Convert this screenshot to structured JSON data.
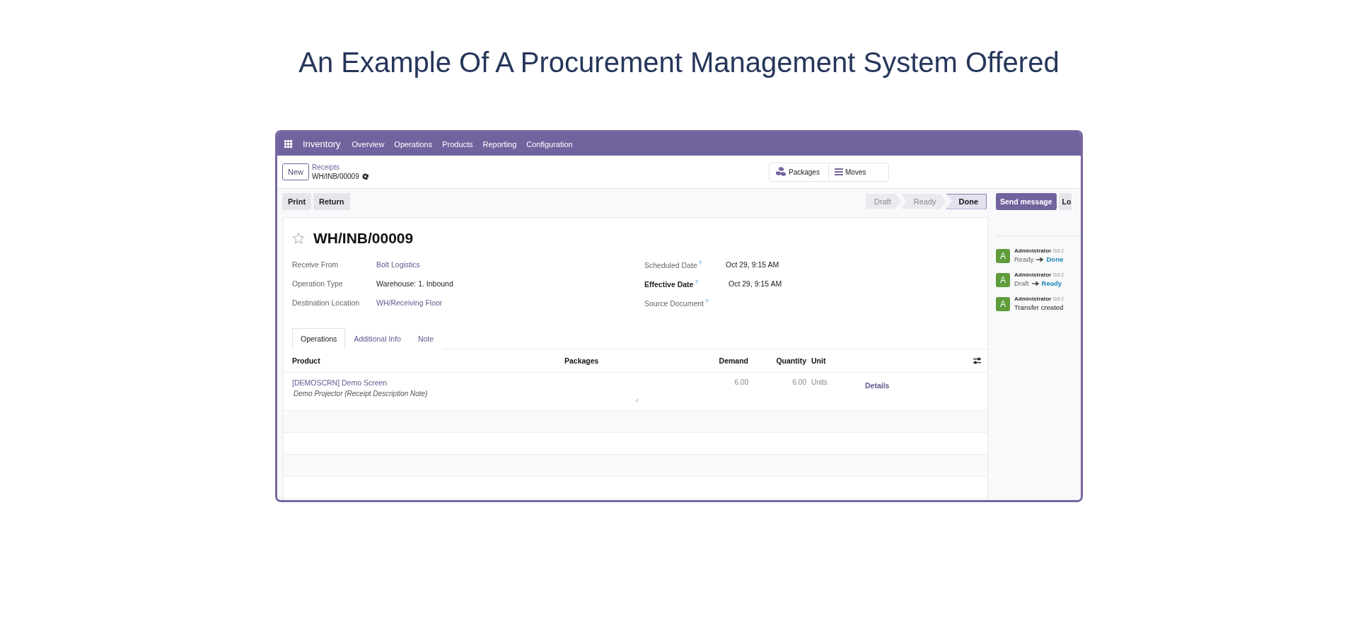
{
  "heading": "An Example Of A Procurement Management System Offered",
  "navbar": {
    "app": "Inventory",
    "menu": [
      "Overview",
      "Operations",
      "Products",
      "Reporting",
      "Configuration"
    ]
  },
  "control_panel": {
    "new_button": "New",
    "breadcrumb": "Receipts",
    "record": "WH/INB/00009",
    "smart_buttons": [
      {
        "label": "Packages",
        "kind": "boxes"
      },
      {
        "label": "Moves",
        "kind": "list"
      }
    ]
  },
  "actions": [
    "Print",
    "Return"
  ],
  "status_steps": [
    {
      "label": "Draft",
      "selected": false
    },
    {
      "label": "Ready",
      "selected": false
    },
    {
      "label": "Done",
      "selected": true
    }
  ],
  "form": {
    "title": "WH/INB/00009",
    "starred": false,
    "left_fields": [
      {
        "label": "Receive From",
        "value": "Bolt Logistics",
        "kind": "link"
      },
      {
        "label": "Operation Type",
        "value": "Warehouse: 1. Inbound",
        "kind": "text"
      },
      {
        "label": "Destination Location",
        "value": "WH/Receiving Floor",
        "kind": "link"
      }
    ],
    "right_fields": [
      {
        "label": "Scheduled Date",
        "help": "?",
        "value": "Oct 29, 9:15 AM",
        "emphasized": false
      },
      {
        "label": "Effective Date",
        "help": "?",
        "value": "Oct 29, 9:15 AM",
        "emphasized": true
      },
      {
        "label": "Source Document",
        "help": "?",
        "emphasized": false
      }
    ]
  },
  "tabs": [
    {
      "label": "Operations",
      "selected": true
    },
    {
      "label": "Additional Info",
      "selected": false
    },
    {
      "label": "Note",
      "selected": false
    }
  ],
  "table": {
    "columns": [
      "Product",
      "Packages",
      "Demand",
      "Quantity",
      "Unit"
    ],
    "rows": [
      {
        "product": "[DEMOSCRN] Demo Screen",
        "description": "Demo Projector (Receipt Description Note)",
        "demand": "6.00",
        "quantity": "6.00",
        "unit": "Units",
        "action": "Details"
      }
    ]
  },
  "chatter": {
    "buttons": [
      "Send message",
      "Lo"
    ],
    "messages": [
      {
        "avatar": "A",
        "author": "Administrator",
        "date": "Oct 2",
        "kind": "tracking",
        "from": "Ready",
        "to": "Done"
      },
      {
        "avatar": "A",
        "author": "Administrator",
        "date": "Oct 2",
        "kind": "tracking",
        "from": "Draft",
        "to": "Ready"
      },
      {
        "avatar": "A",
        "author": "Administrator",
        "date": "Oct 2",
        "kind": "note",
        "text": "Transfer created"
      }
    ]
  }
}
